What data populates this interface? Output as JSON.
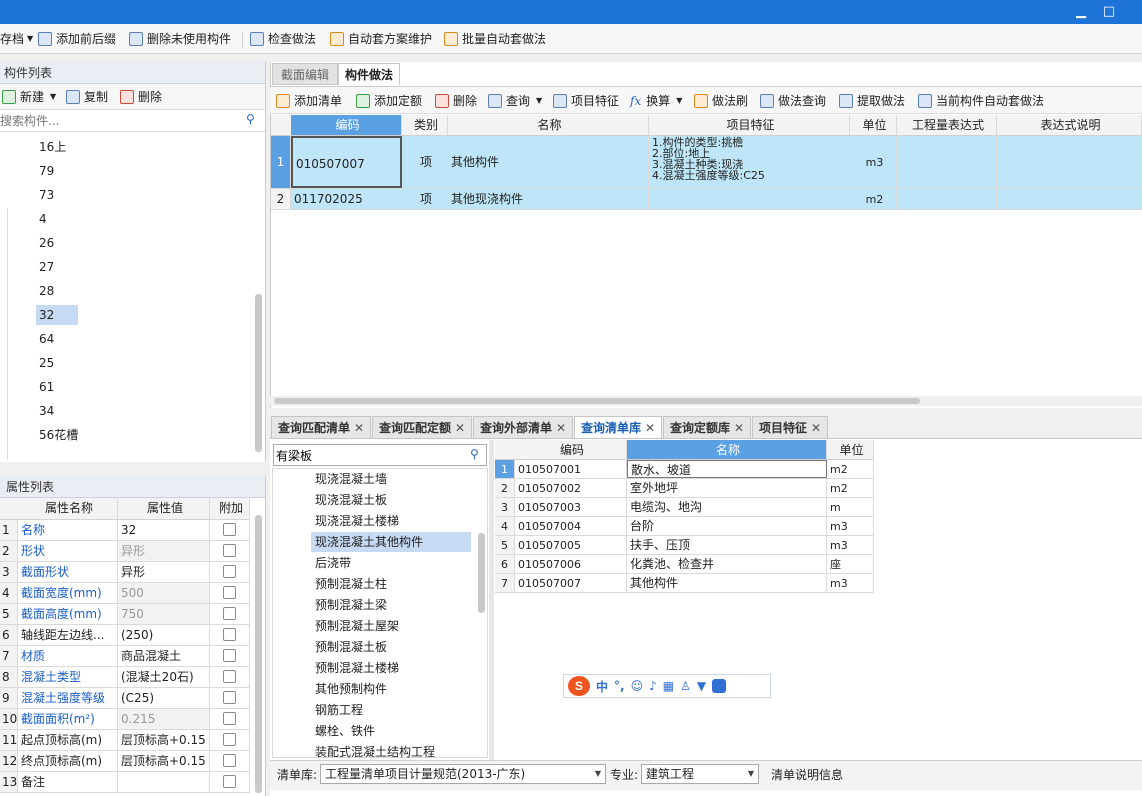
{
  "colors": {
    "titlebar": "#1e73d8",
    "accent": "#5ba0e2",
    "selected": "#c6daf3",
    "link": "#1b5ec8"
  },
  "window": {
    "minimize": "▁",
    "maximize": "□"
  },
  "toolbar": {
    "doc_menu": "存档",
    "add_prefix_suffix": "添加前后缀",
    "delete_unused": "删除未使用构件",
    "check_method": "检查做法",
    "auto_plan_maintain": "自动套方案维护",
    "batch_auto_method": "批量自动套做法"
  },
  "component_list": {
    "title": "构件列表",
    "new_label": "新建",
    "copy_label": "复制",
    "delete_label": "删除",
    "search_placeholder": "搜索构件...",
    "items": [
      "16上",
      "79",
      "73",
      "4",
      "26",
      "27",
      "28",
      "32",
      "64",
      "25",
      "61",
      "34",
      "56花槽"
    ],
    "selected": "32"
  },
  "property_list": {
    "title": "属性列表",
    "headers": [
      "属性名称",
      "属性值",
      "附加"
    ],
    "rows": [
      {
        "num": "1",
        "name": "名称",
        "value": "32"
      },
      {
        "num": "2",
        "name": "形状",
        "value": "异形"
      },
      {
        "num": "3",
        "name": "截面形状",
        "value": "异形"
      },
      {
        "num": "4",
        "name": "截面宽度(mm)",
        "value": "500"
      },
      {
        "num": "5",
        "name": "截面高度(mm)",
        "value": "750"
      },
      {
        "num": "6",
        "name": "轴线距左边线...",
        "value": "(250)"
      },
      {
        "num": "7",
        "name": "材质",
        "value": "商品混凝土"
      },
      {
        "num": "8",
        "name": "混凝土类型",
        "value": "(混凝土20石)"
      },
      {
        "num": "9",
        "name": "混凝土强度等级",
        "value": "(C25)"
      },
      {
        "num": "10",
        "name": "截面面积(m²)",
        "value": "0.215"
      },
      {
        "num": "11",
        "name": "起点顶标高(m)",
        "value": "层顶标高+0.15"
      },
      {
        "num": "12",
        "name": "终点顶标高(m)",
        "value": "层顶标高+0.15"
      },
      {
        "num": "13",
        "name": "备注",
        "value": ""
      }
    ]
  },
  "main_tabs": {
    "section_edit": "截面编辑",
    "component_method": "构件做法"
  },
  "method_toolbar": {
    "add_list": "添加清单",
    "add_quota": "添加定额",
    "delete": "删除",
    "query": "查询",
    "item_feature": "项目特征",
    "convert": "换算",
    "method_brush": "做法刷",
    "method_query": "做法查询",
    "extract_method": "提取做法",
    "current_auto": "当前构件自动套做法"
  },
  "method_table": {
    "headers": [
      "编码",
      "类别",
      "名称",
      "项目特征",
      "单位",
      "工程量表达式",
      "表达式说明"
    ],
    "rows": [
      {
        "num": "1",
        "code": "010507007",
        "type": "项",
        "name": "其他构件",
        "feature": [
          "1.构件的类型:挑檐",
          "2.部位:地上",
          "3.混凝土种类:现浇",
          "4.混凝土强度等级:C25"
        ],
        "unit": "m3"
      },
      {
        "num": "2",
        "code": "011702025",
        "type": "项",
        "name": "其他现浇构件",
        "feature": [],
        "unit": "m2"
      }
    ]
  },
  "bottom_tabs": [
    {
      "label": "查询匹配清单",
      "close": "✕"
    },
    {
      "label": "查询匹配定额",
      "close": "✕"
    },
    {
      "label": "查询外部清单",
      "close": "✕"
    },
    {
      "label": "查询清单库",
      "close": "✕"
    },
    {
      "label": "查询定额库",
      "close": "✕"
    },
    {
      "label": "项目特征",
      "close": "✕"
    }
  ],
  "lib_search": {
    "value": "有梁板"
  },
  "lib_tree": [
    "现浇混凝土墙",
    "现浇混凝土板",
    "现浇混凝土楼梯",
    "现浇混凝土其他构件",
    "后浇带",
    "预制混凝土柱",
    "预制混凝土梁",
    "预制混凝土屋架",
    "预制混凝土板",
    "预制混凝土楼梯",
    "其他预制构件",
    "钢筋工程",
    "螺栓、铁件",
    "装配式混凝土结构工程"
  ],
  "lib_tree_selected": "现浇混凝土其他构件",
  "lib_table": {
    "headers": [
      "编码",
      "名称",
      "单位"
    ],
    "rows": [
      {
        "num": "1",
        "code": "010507001",
        "name": "散水、坡道",
        "unit": "m2"
      },
      {
        "num": "2",
        "code": "010507002",
        "name": "室外地坪",
        "unit": "m2"
      },
      {
        "num": "3",
        "code": "010507003",
        "name": "电缆沟、地沟",
        "unit": "m"
      },
      {
        "num": "4",
        "code": "010507004",
        "name": "台阶",
        "unit": "m3"
      },
      {
        "num": "5",
        "code": "010507005",
        "name": "扶手、压顶",
        "unit": "m3"
      },
      {
        "num": "6",
        "code": "010507006",
        "name": "化粪池、检查井",
        "unit": "座"
      },
      {
        "num": "7",
        "code": "010507007",
        "name": "其他构件",
        "unit": "m3"
      }
    ]
  },
  "lib_footer": {
    "lib_label": "清单库:",
    "lib_value": "工程量清单项目计量规范(2013-广东)",
    "major_label": "专业:",
    "major_value": "建筑工程",
    "info_label": "清单说明信息"
  },
  "ime": {
    "logo": "S",
    "lang": "中",
    "punct": "°,"
  }
}
